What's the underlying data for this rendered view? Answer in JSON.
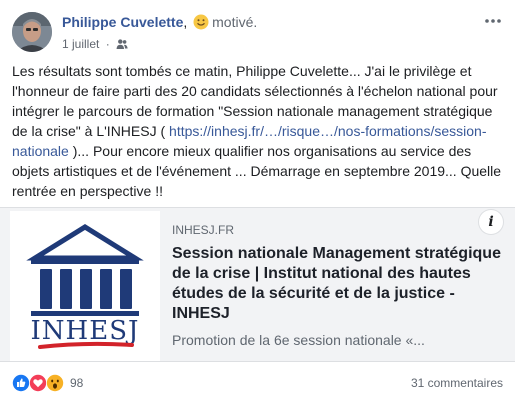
{
  "post": {
    "author": "Philippe Cuvelette",
    "separator": ",",
    "feeling": "motivé.",
    "feeling_icon": "smiling-face-emoji",
    "date": "1 juillet",
    "audience_icon": "friends-icon",
    "text_part1": "Les résultats sont tombés ce matin, Philippe Cuvelette... J'ai le privilège et l'honneur de faire parti des 20 candidats sélectionnés à l'échelon national pour intégrer le parcours de formation \"Session nationale management stratégique de la crise\" à L'INHESJ ( ",
    "text_link": "https://inhesj.fr/…/risque…/nos-formations/session-nationale",
    "text_part2": ")... Pour encore mieux qualifier nos organisations au service des objets artistiques et de l'événement ... Démarrage en septembre 2019... Quelle rentrée en perspective !!"
  },
  "link_card": {
    "domain": "INHESJ.FR",
    "title": "Session nationale Management stratégique de la crise | Institut national des hautes études de la sécurité et de la justice - INHESJ",
    "description": "Promotion de la 6e session nationale «...",
    "logo_text": "INHESJ",
    "info_label": "i"
  },
  "footer": {
    "reaction_icons": [
      "like-icon",
      "love-icon",
      "wow-icon"
    ],
    "reaction_count": "98",
    "comments": "31 commentaires"
  },
  "colors": {
    "link_blue": "#385898",
    "logo_navy": "#1f3a78",
    "logo_red": "#d2232a",
    "like_blue": "#1877f2",
    "love_red": "#f33e58",
    "wow_yellow": "#f7b125"
  }
}
